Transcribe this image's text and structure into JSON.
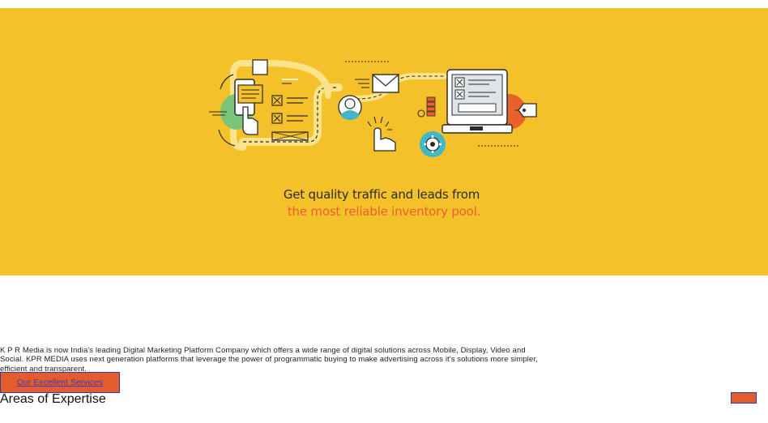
{
  "hero": {
    "tagline_line1": "Get quality traffic and leads from",
    "tagline_line2": "the most reliable inventory pool.",
    "background_color": "#f5c12a",
    "accent_color": "#e8602c",
    "icons": [
      "smartphone-hand-icon",
      "checklist-icon",
      "email-icon",
      "user-icon",
      "clicking-hand-icon",
      "coins-icon",
      "gear-icon",
      "laptop-icon",
      "price-tag-icon"
    ]
  },
  "intro": {
    "text": "K P R Media is now India's leading Digital Marketing Platform Company which offers a wide range of digital solutions across Mobile, Display, Video and Social. KPR MEDIA uses next generation platforms that leverage the power of programmatic buying to make advertising across it's solutions more simpler, efficient and transparent."
  },
  "services_button": {
    "label": "Our Excellent Services"
  },
  "section": {
    "title": "Areas of Expertise"
  }
}
